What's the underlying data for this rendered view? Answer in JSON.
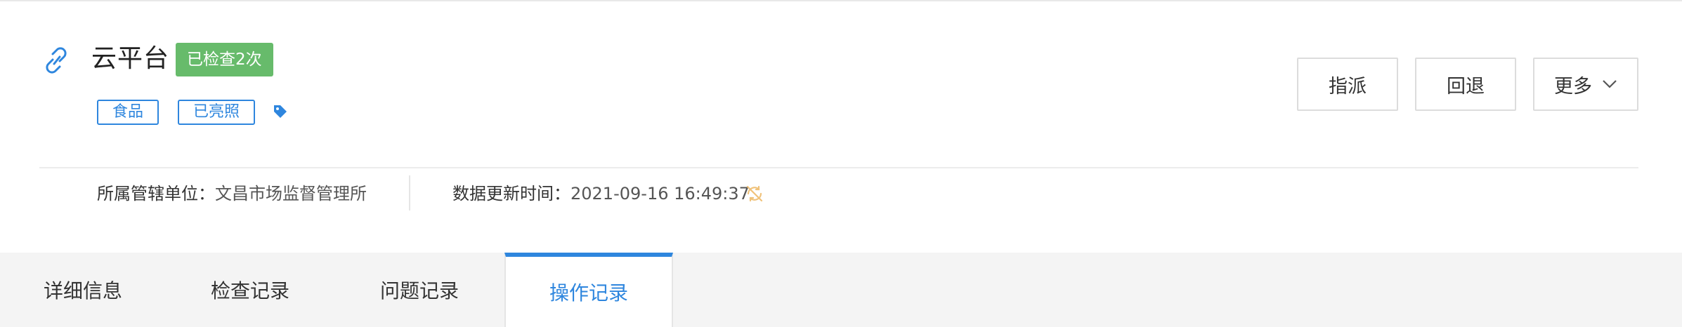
{
  "header": {
    "title": "云平台",
    "check_badge": "已检查2次",
    "tags": [
      "食品",
      "已亮照"
    ]
  },
  "actions": {
    "assign": "指派",
    "rollback": "回退",
    "more": "更多"
  },
  "meta": {
    "unit_label": "所属管辖单位：",
    "unit_value": "文昌市场监督管理所",
    "updated_label": "数据更新时间：",
    "updated_value": "2021-09-16 16:49:37"
  },
  "tabs": [
    {
      "label": "详细信息"
    },
    {
      "label": "检查记录"
    },
    {
      "label": "问题记录"
    },
    {
      "label": "操作记录",
      "active": true
    }
  ],
  "colors": {
    "accent": "#2e86de",
    "badge_green": "#67bb6b",
    "sync_icon": "#f0c27a"
  }
}
